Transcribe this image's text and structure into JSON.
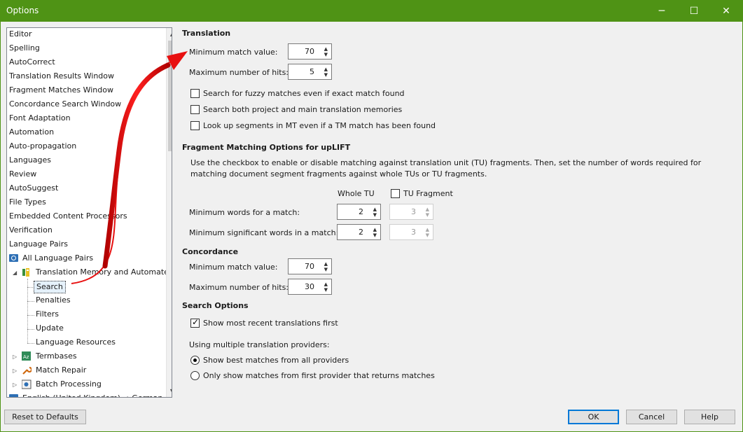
{
  "window": {
    "title": "Options",
    "min_glyph": "─",
    "max_glyph": "☐",
    "close_glyph": "✕"
  },
  "tree": {
    "items": [
      "Editor",
      "Spelling",
      "AutoCorrect",
      "Translation Results Window",
      "Fragment Matches Window",
      "Concordance Search Window",
      "Font Adaptation",
      "Automation",
      "Auto-propagation",
      "Languages",
      "Review",
      "AutoSuggest",
      "File Types",
      "Embedded Content Processors",
      "Verification",
      "Language Pairs"
    ],
    "all_language_pairs": "All Language Pairs",
    "tm_node": "Translation Memory and Automated Translation",
    "tm_children": [
      "Search",
      "Penalties",
      "Filters",
      "Update",
      "Language Resources"
    ],
    "termbases": "Termbases",
    "match_repair": "Match Repair",
    "batch_processing": "Batch Processing",
    "last_partial": "English (United Kingdom) → German (Germany)"
  },
  "translation": {
    "heading": "Translation",
    "min_match_label": "Minimum match value:",
    "min_match_value": "70",
    "max_hits_label": "Maximum number of hits:",
    "max_hits_value": "5",
    "checkboxes": [
      {
        "label": "Search for fuzzy matches even if exact match found",
        "checked": false
      },
      {
        "label": "Search both project and main translation memories",
        "checked": false
      },
      {
        "label": "Look up segments in MT even if a TM match has been found",
        "checked": false
      }
    ]
  },
  "fragment": {
    "heading": "Fragment Matching Options for upLIFT",
    "description": "Use the checkbox to enable or disable matching against translation unit (TU)  fragments. Then, set the number of words required for matching document segment fragments against whole TUs or TU fragments.",
    "whole_tu_label": "Whole TU",
    "tu_fragment_label": "TU Fragment",
    "min_words_label": "Minimum words for a match:",
    "min_words_whole": "2",
    "min_words_fragment": "3",
    "min_sig_label": "Minimum significant words in a match:",
    "min_sig_whole": "2",
    "min_sig_fragment": "3"
  },
  "concordance": {
    "heading": "Concordance",
    "min_match_label": "Minimum match value:",
    "min_match_value": "70",
    "max_hits_label": "Maximum number of hits:",
    "max_hits_value": "30"
  },
  "search_options": {
    "heading": "Search Options",
    "recent_first_label": "Show most recent translations first",
    "multi_label": "Using multiple translation providers:",
    "radio_best": "Show best matches from all providers",
    "radio_first": "Only show matches from first provider that returns matches"
  },
  "buttons": {
    "reset": "Reset to Defaults",
    "ok": "OK",
    "cancel": "Cancel",
    "help": "Help"
  },
  "colors": {
    "titlebar": "#4f9315",
    "arrow": "#e81010",
    "selection_border": "#0078d7"
  }
}
